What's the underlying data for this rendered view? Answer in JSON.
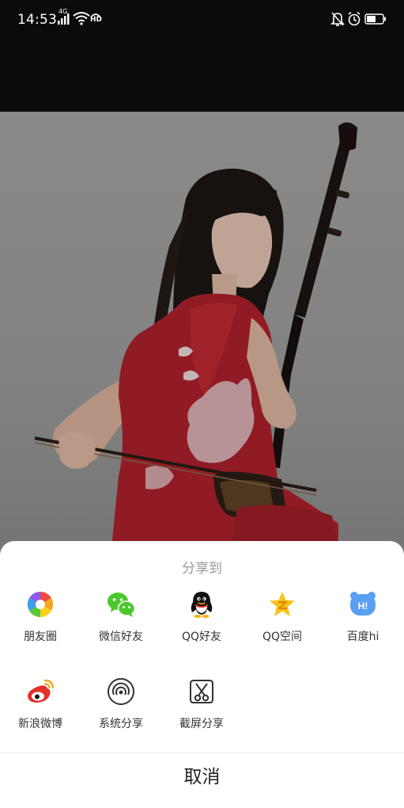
{
  "status_bar": {
    "time": "14:53",
    "signal_tag": "4G",
    "hd_tag": "HD",
    "icons": [
      "signal-icon",
      "wifi-icon",
      "hd-voice-icon",
      "mute-bell-icon",
      "alarm-icon",
      "battery-icon"
    ]
  },
  "photo": {
    "icon": "photo-erhu-player"
  },
  "share_sheet": {
    "title": "分享到",
    "items": [
      {
        "label": "朋友圈",
        "icon": "moments-icon"
      },
      {
        "label": "微信好友",
        "icon": "wechat-icon"
      },
      {
        "label": "QQ好友",
        "icon": "qq-icon"
      },
      {
        "label": "QQ空间",
        "icon": "qzone-icon"
      },
      {
        "label": "百度hi",
        "icon": "baidu-hi-icon"
      },
      {
        "label": "新浪微博",
        "icon": "weibo-icon"
      },
      {
        "label": "系统分享",
        "icon": "system-share-icon"
      },
      {
        "label": "截屏分享",
        "icon": "screenshot-share-icon"
      }
    ],
    "cancel_label": "取消"
  },
  "colors": {
    "moments_red": "#f04a43",
    "wechat_green": "#4cc82e",
    "qzone_yellow": "#f7c21c",
    "baidu_blue": "#5a9ff0",
    "weibo_red": "#e2302a"
  }
}
